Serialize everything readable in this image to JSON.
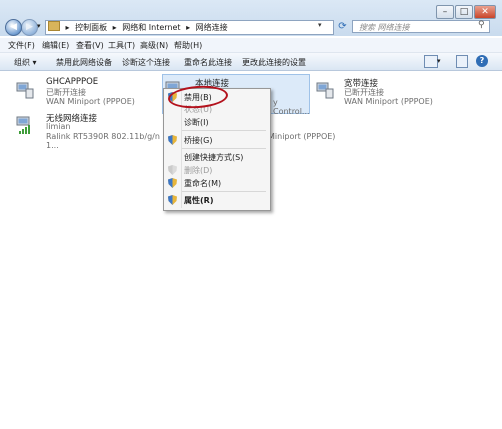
{
  "address": {
    "parts": [
      "控制面板",
      "网络和 Internet",
      "网络连接"
    ],
    "separators": [
      "▸",
      "▸",
      "▸"
    ]
  },
  "search": {
    "placeholder": "搜索 网络连接"
  },
  "menubar": [
    "文件(F)",
    "编辑(E)",
    "查看(V)",
    "工具(T)",
    "高级(N)",
    "帮助(H)"
  ],
  "toolbar": [
    "组织 ▾",
    "禁用此网络设备",
    "诊断这个连接",
    "重命名此连接",
    "更改此连接的设置"
  ],
  "connections": [
    {
      "name": "GHCAPPPOE",
      "status": "已断开连接",
      "device": "WAN Miniport (PPPOE)"
    },
    {
      "name": "本地连接",
      "status": "",
      "device": "y Control..."
    },
    {
      "name": "宽带连接",
      "status": "已断开连接",
      "device": "WAN Miniport (PPPOE)"
    },
    {
      "name": "无线网络连接",
      "status": "limian",
      "device": "Ralink RT5390R 802.11b/g/n 1..."
    },
    {
      "name": "",
      "status": "",
      "device": "Miniport (PPPOE)"
    }
  ],
  "context_menu": {
    "items": [
      {
        "label": "禁用(B)",
        "enabled": true,
        "shield": true,
        "highlighted": true
      },
      {
        "label": "状态(U)",
        "enabled": false,
        "shield": false
      },
      {
        "label": "诊断(I)",
        "enabled": true,
        "shield": false
      },
      {
        "label": "桥接(G)",
        "enabled": true,
        "shield": true
      },
      {
        "label": "创建快捷方式(S)",
        "enabled": true,
        "shield": false
      },
      {
        "label": "删除(D)",
        "enabled": false,
        "shield": true
      },
      {
        "label": "重命名(M)",
        "enabled": true,
        "shield": true
      },
      {
        "label": "属性(R)",
        "enabled": true,
        "shield": true,
        "bold": true
      }
    ]
  },
  "colors": {
    "highlight_circle": "#b3121d",
    "accent": "#2f6db5"
  }
}
